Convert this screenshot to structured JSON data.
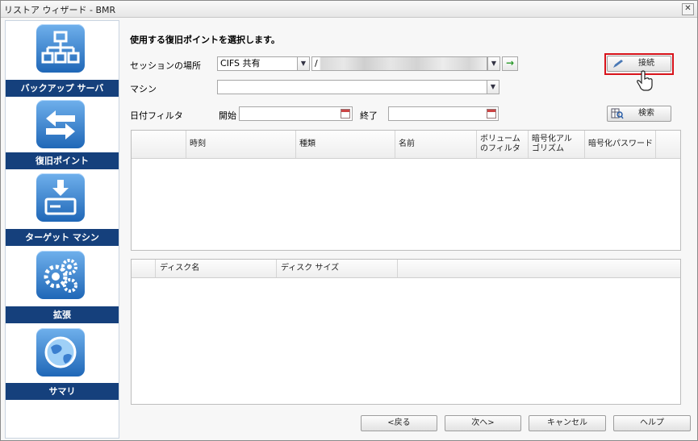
{
  "window": {
    "title": "リストア ウィザード - BMR",
    "close_glyph": "✕"
  },
  "sidebar": {
    "items": [
      {
        "label": "バックアップ サーバ",
        "icon": "network-icon"
      },
      {
        "label": "復旧ポイント",
        "icon": "arrows-icon"
      },
      {
        "label": "ターゲット マシン",
        "icon": "drive-download-icon"
      },
      {
        "label": "拡張",
        "icon": "gears-icon"
      },
      {
        "label": "サマリ",
        "icon": "globe-icon"
      }
    ]
  },
  "main": {
    "heading": "使用する復旧ポイントを選択します。",
    "session_label": "セッションの場所",
    "session_type": "CIFS 共有",
    "session_path": "/",
    "connect_label": "接続",
    "machine_label": "マシン",
    "machine_value": "",
    "date_filter_label": "日付フィルタ",
    "start_label": "開始",
    "end_label": "終了",
    "start_value": "",
    "end_value": "",
    "search_label": "検索",
    "recovery_table": {
      "headers": [
        "",
        "時刻",
        "種類",
        "名前",
        "ボリューム\nのフィルタ",
        "暗号化アル\nゴリズム",
        "暗号化パスワード"
      ]
    },
    "disk_table": {
      "headers": [
        "",
        "ディスク名",
        "ディスク サイズ",
        ""
      ]
    }
  },
  "footer": {
    "back_label": "<戻る",
    "next_label": "次へ>",
    "cancel_label": "キャンセル",
    "help_label": "ヘルプ"
  },
  "colors": {
    "nav_label_bg": "#15407c",
    "highlight": "#d8131b",
    "icon_blue": "#1f67b7"
  }
}
